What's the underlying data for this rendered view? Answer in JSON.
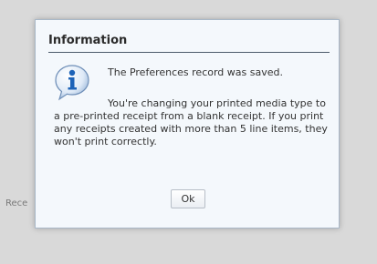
{
  "background": {
    "partial_text": "Rece"
  },
  "dialog": {
    "title": "Information",
    "message_line1": "The Preferences record was saved.",
    "message_line2": "You're changing your printed media type to a pre-printed receipt from a blank receipt. If you print any receipts created with more than 5 line items, they won't print correctly.",
    "ok_label": "Ok",
    "icon": "info-icon"
  },
  "colors": {
    "header_rule": "#4b5a6a",
    "icon_blue": "#1d63b8"
  }
}
